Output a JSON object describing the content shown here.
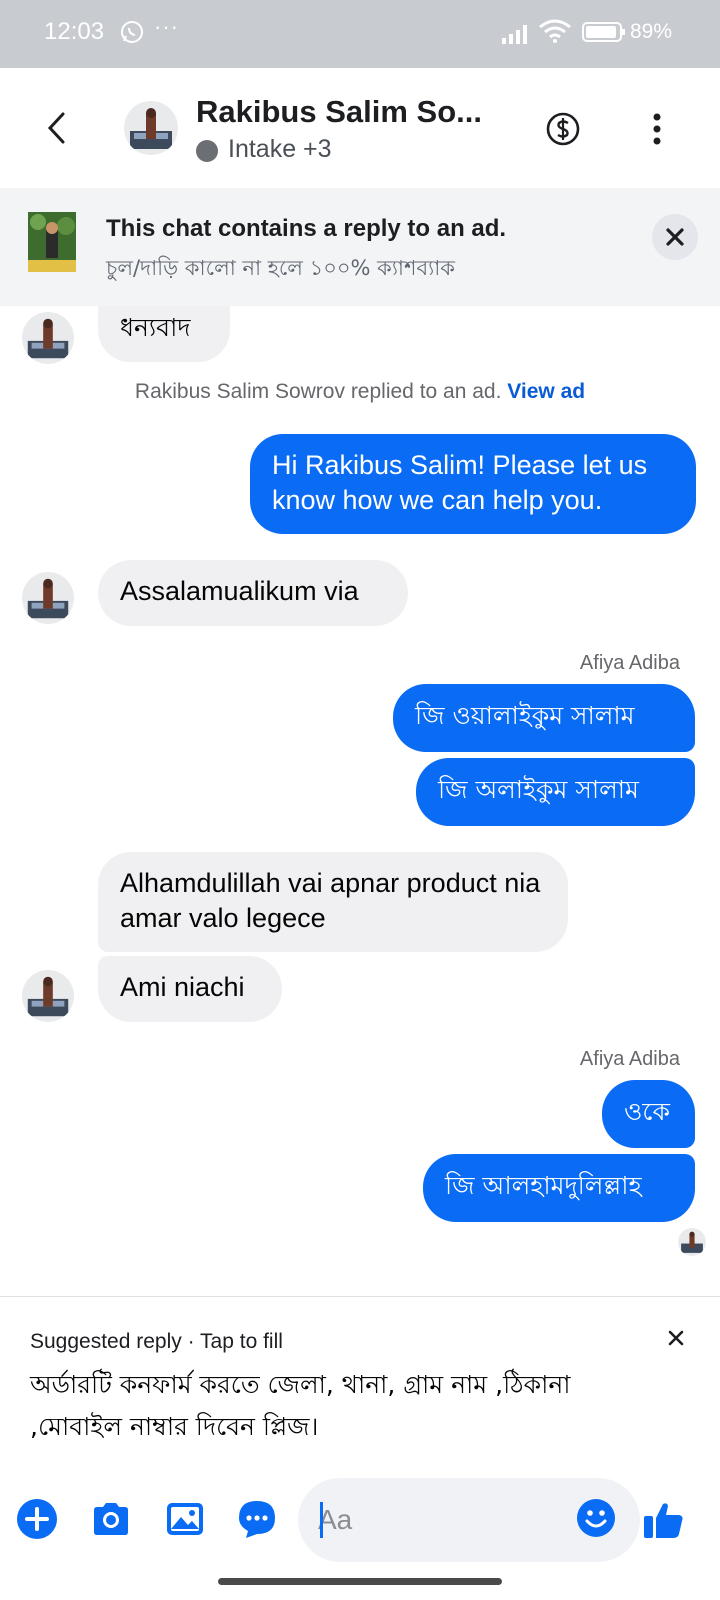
{
  "status_bar": {
    "time": "12:03",
    "more_dots": "···",
    "battery": "89%"
  },
  "header": {
    "contact_name": "Rakibus Salim So...",
    "presence": "Intake +3"
  },
  "ad_banner": {
    "title": "This chat contains a reply to an ad.",
    "subtitle": "চুল/দাড়ি  কালো না হলে ১০০% ক্যাশব্যাক",
    "close_glyph": "✕"
  },
  "messages": {
    "m1": "ধন্যবাদ",
    "system_note": "Rakibus Salim Sowrov replied to an ad.",
    "view_ad": "View ad",
    "m2": "Hi Rakibus Salim! Please let us know how we can help you.",
    "m3": "Assalamualikum via",
    "sender1": "Afiya Adiba",
    "m4": "জি ওয়ালাইকুম সালাম",
    "m5": "জি অলাইকুম সালাম",
    "m6": "Alhamdulillah  vai apnar product nia amar valo legece",
    "m7": "Ami niachi",
    "sender2": "Afiya Adiba",
    "m8": "ওকে",
    "m9": "জি আলহামদুলিল্লাহ"
  },
  "suggested_reply": {
    "label": "Suggested reply · Tap to fill",
    "text": "অর্ডারটি কনফার্ম করতে জেলা, থানা, গ্রাম নাম ,ঠিকানা ,মোবাইল নাম্বার দিবেন প্লিজ।"
  },
  "composer": {
    "placeholder": "Aa"
  },
  "colors": {
    "accent": "#0a6cf5",
    "incoming_bubble": "#f0f0f2",
    "status_bar": "#c8cbd0"
  },
  "icons": [
    "whatsapp-icon",
    "signal-icon",
    "wifi-icon",
    "battery-icon",
    "back-arrow-icon",
    "dollar-icon",
    "more-vertical-icon",
    "close-icon",
    "plus-icon",
    "camera-icon",
    "gallery-icon",
    "chat-bubble-icon",
    "emoji-icon",
    "thumbs-up-icon"
  ]
}
